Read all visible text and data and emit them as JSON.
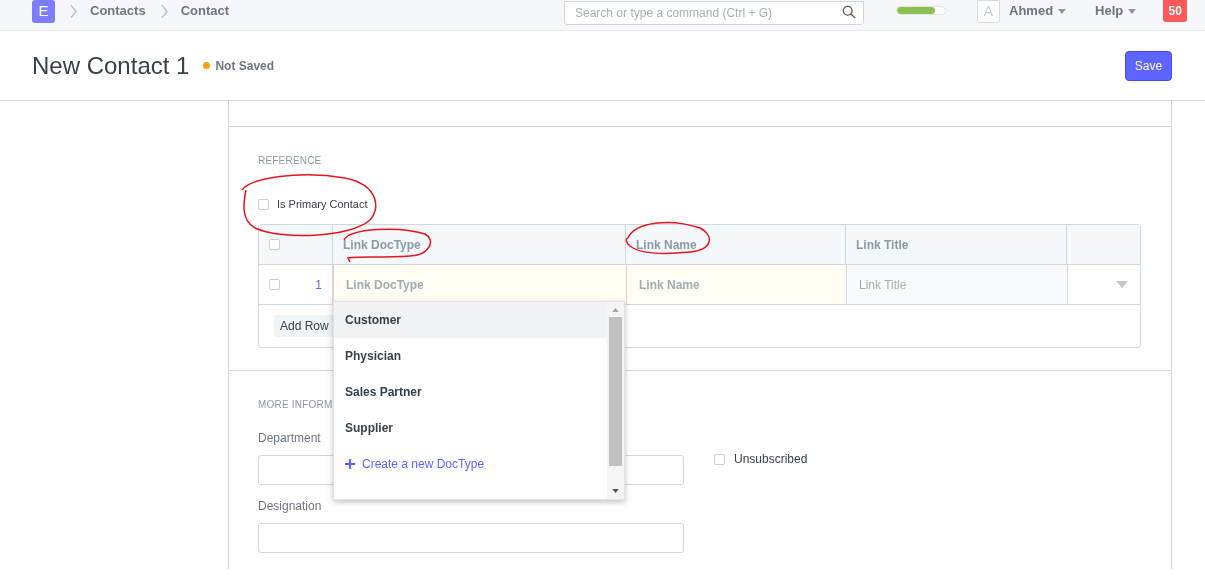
{
  "navbar": {
    "logo": "E",
    "breadcrumbs": [
      "Contacts",
      "Contact"
    ],
    "search": {
      "placeholder": "Search or type a command (Ctrl + G)"
    },
    "progress": {
      "level": 0.8
    },
    "avatar": "A",
    "user": "Ahmed",
    "help": "Help",
    "notifications": "50"
  },
  "header": {
    "title": "New Contact 1",
    "status": "Not Saved",
    "save": "Save"
  },
  "reference": {
    "heading": "REFERENCE",
    "primary": {
      "label": "Is Primary Contact",
      "checked": false
    },
    "table": {
      "all_checked": false,
      "columns": [
        "Link DocType",
        "Link Name",
        "Link Title"
      ],
      "rows": [
        {
          "index": "1",
          "checked": false,
          "cells": [
            {
              "placeholder": "Link DocType",
              "kind": "mandatory"
            },
            {
              "placeholder": "Link Name",
              "kind": "mandatory"
            },
            {
              "placeholder": "Link Title",
              "kind": "readonly"
            }
          ]
        }
      ],
      "add_row": "Add Row"
    }
  },
  "dropdown": {
    "items": [
      {
        "label": "Customer",
        "selected": true
      },
      {
        "label": "Physician",
        "selected": false
      },
      {
        "label": "Sales Partner",
        "selected": false
      },
      {
        "label": "Supplier",
        "selected": false
      }
    ],
    "create": "Create a new DocType"
  },
  "more_info": {
    "heading": "MORE INFORM",
    "fields": [
      {
        "label": "Department"
      },
      {
        "label": "Designation"
      }
    ],
    "unsubscribed": {
      "label": "Unsubscribed",
      "checked": false
    }
  }
}
